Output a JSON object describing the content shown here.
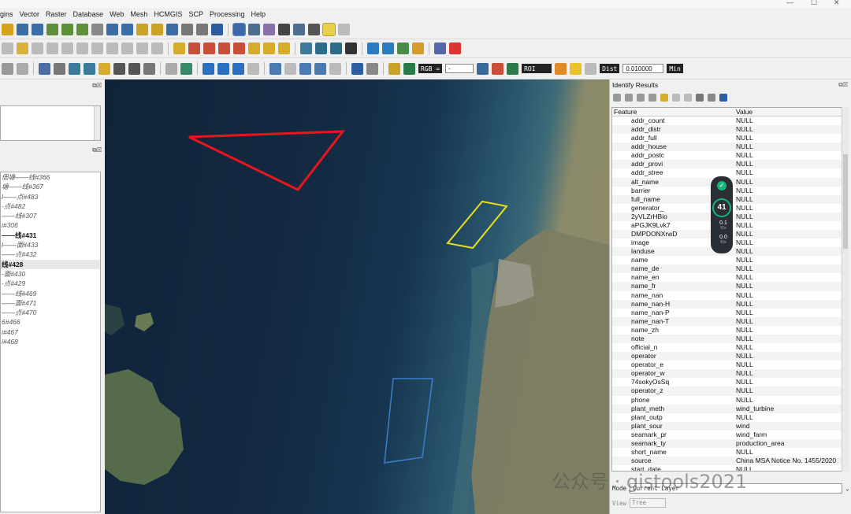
{
  "window": {
    "minimize": "—",
    "maximize": "☐",
    "close": "✕"
  },
  "menu": [
    "gins",
    "Vector",
    "Raster",
    "Database",
    "Web",
    "Mesh",
    "HCMGIS",
    "SCP",
    "Processing",
    "Help"
  ],
  "toolbar3": {
    "rgb_label": "RGB =",
    "rgb_value": "-",
    "roi_label": "ROI",
    "dist_label": "Dist",
    "dist_value": "0.010000",
    "min_label": "Min"
  },
  "left_panel": {
    "layers": [
      {
        "label": "佃塘——线#366",
        "bold": false
      },
      {
        "label": "塘——线#367",
        "bold": false
      },
      {
        "label": "l——点#483",
        "bold": false
      },
      {
        "label": "-点#482",
        "bold": false
      },
      {
        "label": "——线#307",
        "bold": false
      },
      {
        "label": "i#306",
        "bold": false
      },
      {
        "label": "——线#431",
        "bold": true
      },
      {
        "label": "l——面#433",
        "bold": false
      },
      {
        "label": "——点#432",
        "bold": false
      },
      {
        "label": "线#428",
        "bold": true,
        "selected": true
      },
      {
        "label": "-面#430",
        "bold": false
      },
      {
        "label": "-点#429",
        "bold": false
      },
      {
        "label": "——线#469",
        "bold": false
      },
      {
        "label": "——面#471",
        "bold": false
      },
      {
        "label": "——点#470",
        "bold": false
      },
      {
        "label": "6#466",
        "bold": false
      },
      {
        "label": "i#467",
        "bold": false
      },
      {
        "label": "i#468",
        "bold": false
      }
    ]
  },
  "identify": {
    "title": "Identify Results",
    "col_feature": "Feature",
    "col_value": "Value",
    "rows": [
      {
        "f": "addr_count",
        "v": "NULL"
      },
      {
        "f": "addr_distr",
        "v": "NULL"
      },
      {
        "f": "addr_full",
        "v": "NULL"
      },
      {
        "f": "addr_house",
        "v": "NULL"
      },
      {
        "f": "addr_postc",
        "v": "NULL"
      },
      {
        "f": "addr_provi",
        "v": "NULL"
      },
      {
        "f": "addr_stree",
        "v": "NULL"
      },
      {
        "f": "alt_name",
        "v": "NULL"
      },
      {
        "f": "barrier",
        "v": "NULL"
      },
      {
        "f": "full_name",
        "v": "NULL"
      },
      {
        "f": "generator_",
        "v": "NULL"
      },
      {
        "f": "2yVLZrHBio",
        "v": "NULL"
      },
      {
        "f": "aPGJK9Lvk7",
        "v": "NULL"
      },
      {
        "f": "DMPDONXrwD",
        "v": "NULL"
      },
      {
        "f": "image",
        "v": "NULL"
      },
      {
        "f": "landuse",
        "v": "NULL"
      },
      {
        "f": "name",
        "v": "NULL"
      },
      {
        "f": "name_de",
        "v": "NULL"
      },
      {
        "f": "name_en",
        "v": "NULL"
      },
      {
        "f": "name_fr",
        "v": "NULL"
      },
      {
        "f": "name_nan",
        "v": "NULL"
      },
      {
        "f": "name_nan-H",
        "v": "NULL"
      },
      {
        "f": "name_nan-P",
        "v": "NULL"
      },
      {
        "f": "name_nan-T",
        "v": "NULL"
      },
      {
        "f": "name_zh",
        "v": "NULL"
      },
      {
        "f": "note",
        "v": "NULL"
      },
      {
        "f": "official_n",
        "v": "NULL"
      },
      {
        "f": "operator",
        "v": "NULL"
      },
      {
        "f": "operator_e",
        "v": "NULL"
      },
      {
        "f": "operator_w",
        "v": "NULL"
      },
      {
        "f": "74sokyOsSq",
        "v": "NULL"
      },
      {
        "f": "operator_z",
        "v": "NULL"
      },
      {
        "f": "phone",
        "v": "NULL"
      },
      {
        "f": "plant_meth",
        "v": "wind_turbine"
      },
      {
        "f": "plant_outp",
        "v": "NULL"
      },
      {
        "f": "plant_sour",
        "v": "wind"
      },
      {
        "f": "seamark_pr",
        "v": "wind_farm"
      },
      {
        "f": "seamark_ty",
        "v": "production_area"
      },
      {
        "f": "short_name",
        "v": "NULL"
      },
      {
        "f": "source",
        "v": "China MSA Notice No. 1455/2020"
      },
      {
        "f": "start_date",
        "v": "NULL"
      }
    ],
    "mode_label": "Mode",
    "mode_value": "Current Layer",
    "view_label": "View",
    "view_value": "Tree"
  },
  "net_widget": {
    "percent": "41",
    "upload": "0.1",
    "download": "0.0",
    "unit": "K/s"
  },
  "watermark": "公众号 · gistools2021",
  "colors": {
    "triangle": "#e8161b",
    "yellow_box": "#e6e01a",
    "blue_box": "#3b7fc8",
    "widget_green": "#17b57e"
  }
}
